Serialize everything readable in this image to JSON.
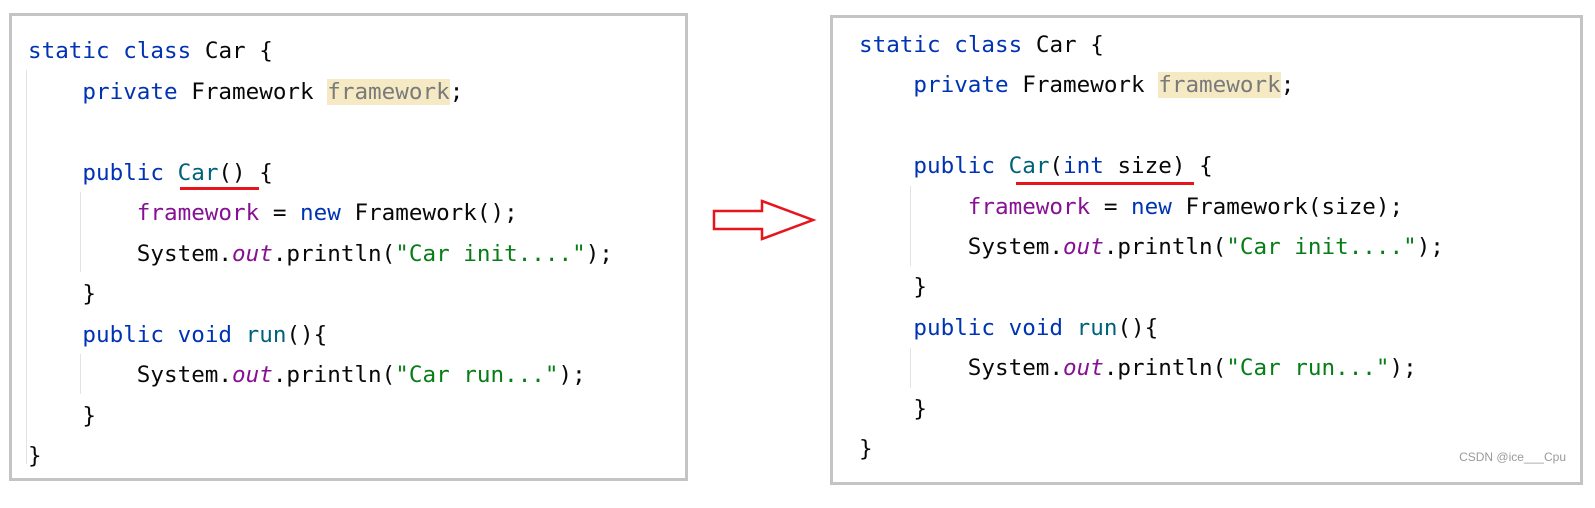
{
  "left": {
    "lines": [
      {
        "indent": 0,
        "tokens": [
          [
            "static class ",
            "kw"
          ],
          [
            "Car {",
            ""
          ]
        ]
      },
      {
        "indent": 1,
        "tokens": [
          [
            "private ",
            "kw"
          ],
          [
            "Framework ",
            ""
          ],
          [
            "framework",
            "unused"
          ],
          [
            ";",
            ""
          ]
        ]
      },
      {
        "indent": 0,
        "tokens": []
      },
      {
        "indent": 1,
        "tokens": [
          [
            "public ",
            "kw"
          ],
          [
            "Car",
            "fn"
          ],
          [
            "() {",
            ""
          ]
        ]
      },
      {
        "indent": 2,
        "tokens": [
          [
            "framework",
            "fld"
          ],
          [
            " = ",
            ""
          ],
          [
            "new ",
            "kw"
          ],
          [
            "Framework();",
            ""
          ]
        ]
      },
      {
        "indent": 2,
        "tokens": [
          [
            "System.",
            ""
          ],
          [
            "out",
            "it"
          ],
          [
            ".println(",
            ""
          ],
          [
            "\"Car init....\"",
            "str"
          ],
          [
            ");",
            ""
          ]
        ]
      },
      {
        "indent": 1,
        "tokens": [
          [
            "}",
            ""
          ]
        ]
      },
      {
        "indent": 1,
        "tokens": [
          [
            "public void ",
            "kw"
          ],
          [
            "run",
            "fn"
          ],
          [
            "(){",
            ""
          ]
        ]
      },
      {
        "indent": 2,
        "tokens": [
          [
            "System.",
            ""
          ],
          [
            "out",
            "it"
          ],
          [
            ".println(",
            ""
          ],
          [
            "\"Car run...\"",
            "str"
          ],
          [
            ");",
            ""
          ]
        ]
      },
      {
        "indent": 1,
        "tokens": [
          [
            "}",
            ""
          ]
        ]
      },
      {
        "indent": 0,
        "tokens": [
          [
            "}",
            ""
          ]
        ]
      }
    ]
  },
  "right": {
    "lines": [
      {
        "indent": 0,
        "tokens": [
          [
            "static class ",
            "kw"
          ],
          [
            "Car {",
            ""
          ]
        ]
      },
      {
        "indent": 1,
        "tokens": [
          [
            "private ",
            "kw"
          ],
          [
            "Framework ",
            ""
          ],
          [
            "framework",
            "unused"
          ],
          [
            ";",
            ""
          ]
        ]
      },
      {
        "indent": 0,
        "tokens": []
      },
      {
        "indent": 1,
        "tokens": [
          [
            "public ",
            "kw"
          ],
          [
            "Car",
            "fn"
          ],
          [
            "(",
            ""
          ],
          [
            "int ",
            "kw"
          ],
          [
            "size) {",
            ""
          ]
        ]
      },
      {
        "indent": 2,
        "tokens": [
          [
            "framework",
            "fld"
          ],
          [
            " = ",
            ""
          ],
          [
            "new ",
            "kw"
          ],
          [
            "Framework(size);",
            ""
          ]
        ]
      },
      {
        "indent": 2,
        "tokens": [
          [
            "System.",
            ""
          ],
          [
            "out",
            "it"
          ],
          [
            ".println(",
            ""
          ],
          [
            "\"Car init....\"",
            "str"
          ],
          [
            ");",
            ""
          ]
        ]
      },
      {
        "indent": 1,
        "tokens": [
          [
            "}",
            ""
          ]
        ]
      },
      {
        "indent": 1,
        "tokens": [
          [
            "public void ",
            "kw"
          ],
          [
            "run",
            "fn"
          ],
          [
            "(){",
            ""
          ]
        ]
      },
      {
        "indent": 2,
        "tokens": [
          [
            "System.",
            ""
          ],
          [
            "out",
            "it"
          ],
          [
            ".println(",
            ""
          ],
          [
            "\"Car run...\"",
            "str"
          ],
          [
            ");",
            ""
          ]
        ]
      },
      {
        "indent": 1,
        "tokens": [
          [
            "}",
            ""
          ]
        ]
      },
      {
        "indent": 0,
        "tokens": [
          [
            "}",
            ""
          ]
        ]
      }
    ]
  },
  "arrow_icon": "right-arrow-outline-icon",
  "colors": {
    "keyword": "#0033b3",
    "method": "#00627a",
    "field": "#871094",
    "string": "#067d17",
    "highlight": "#f5eac4",
    "annotation": "#e8141c"
  },
  "watermark": "CSDN @ice___Cpu"
}
